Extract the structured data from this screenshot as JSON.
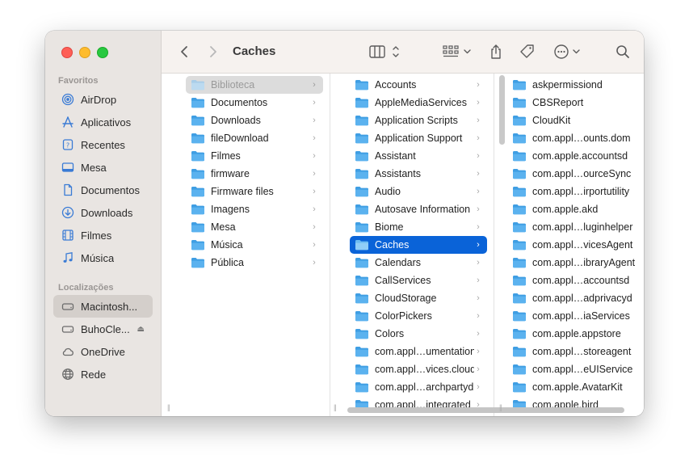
{
  "window": {
    "title": "Caches",
    "accent": "#0a63d8"
  },
  "sidebar": {
    "favorites_title": "Favoritos",
    "favorites": [
      {
        "label": "AirDrop",
        "icon": "airdrop-icon"
      },
      {
        "label": "Aplicativos",
        "icon": "applications-icon"
      },
      {
        "label": "Recentes",
        "icon": "recents-icon"
      },
      {
        "label": "Mesa",
        "icon": "desktop-icon"
      },
      {
        "label": "Documentos",
        "icon": "document-icon"
      },
      {
        "label": "Downloads",
        "icon": "downloads-icon"
      },
      {
        "label": "Filmes",
        "icon": "film-icon"
      },
      {
        "label": "Música",
        "icon": "music-icon"
      }
    ],
    "locations_title": "Localizações",
    "locations": [
      {
        "label": "Macintosh...",
        "icon": "disk-icon"
      },
      {
        "label": "BuhoCle...",
        "icon": "disk-icon"
      },
      {
        "label": "OneDrive",
        "icon": "cloud-icon"
      },
      {
        "label": "Rede",
        "icon": "network-icon"
      }
    ],
    "eject_glyph": "⏏"
  },
  "columns": [
    {
      "items": [
        "Biblioteca",
        "Documentos",
        "Downloads",
        "fileDownload",
        "Filmes",
        "firmware",
        "Firmware files",
        "Imagens",
        "Mesa",
        "Música",
        "Pública"
      ]
    },
    {
      "items": [
        "Accounts",
        "AppleMediaServices",
        "Application Scripts",
        "Application Support",
        "Assistant",
        "Assistants",
        "Audio",
        "Autosave Information",
        "Biome",
        "Caches",
        "Calendars",
        "CallServices",
        "CloudStorage",
        "ColorPickers",
        "Colors",
        "com.appl…umentation",
        "com.appl…vices.cloud",
        "com.appl…archpartyd",
        "com.appl…integrated"
      ]
    },
    {
      "items": [
        "askpermissiond",
        "CBSReport",
        "CloudKit",
        "com.appl…ounts.dom",
        "com.apple.accountsd",
        "com.appl…ourceSync",
        "com.appl…irportutility",
        "com.apple.akd",
        "com.appl…luginhelper",
        "com.appl…vicesAgent",
        "com.appl…ibraryAgent",
        "com.appl…accountsd",
        "com.appl…adprivacyd",
        "com.appl…iaServices",
        "com.apple.appstore",
        "com.appl…storeagent",
        "com.appl…eUIService",
        "com.apple.AvatarKit",
        "com.apple.bird"
      ]
    }
  ],
  "chevron": "›",
  "resize_glyph": "||"
}
